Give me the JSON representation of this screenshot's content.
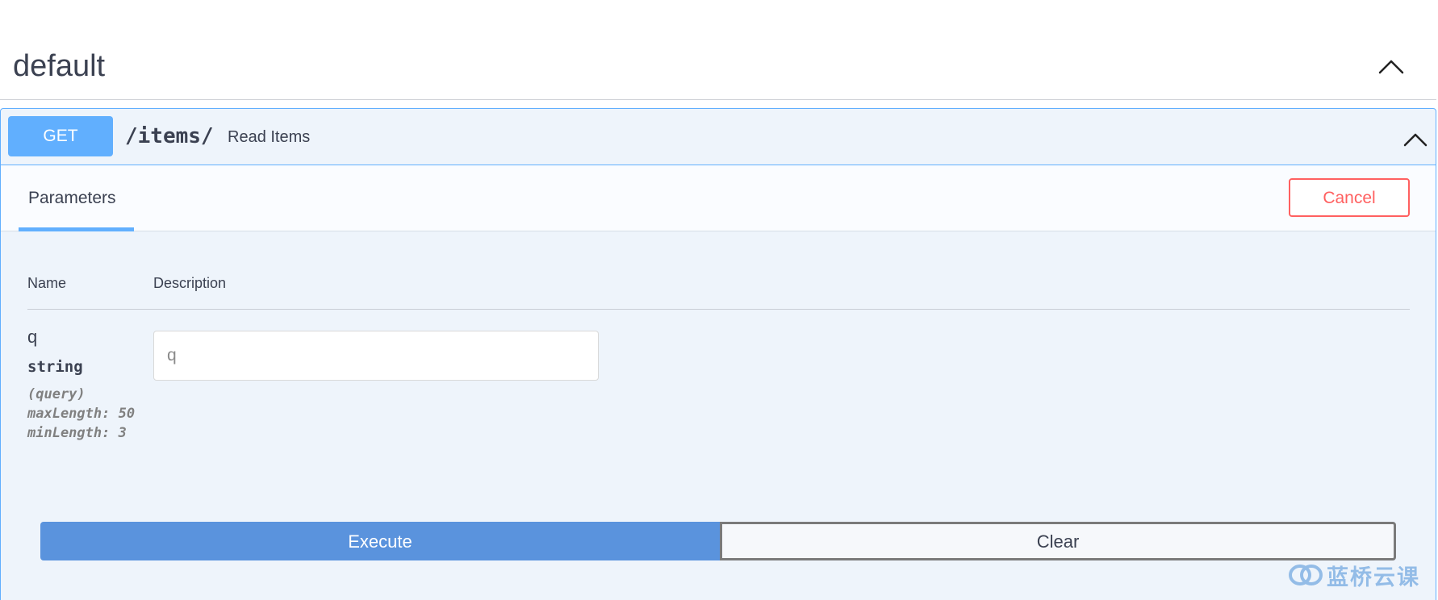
{
  "section": {
    "title": "default",
    "toggle_icon": "chevron-up-icon"
  },
  "operation": {
    "method": "GET",
    "path": "/items/",
    "summary": "Read Items",
    "toggle_icon": "chevron-up-icon",
    "colors": {
      "method_badge": "#61affe",
      "block_background": "#eef4fb",
      "block_border": "#61affe"
    }
  },
  "parameters_panel": {
    "tab_label": "Parameters",
    "cancel_label": "Cancel",
    "cancel_color": "#ff6060",
    "columns": {
      "name": "Name",
      "description": "Description"
    },
    "params": [
      {
        "name": "q",
        "type": "string",
        "in": "(query)",
        "max_length": "maxLength: 50",
        "min_length": "minLength: 3",
        "input_value": "",
        "input_placeholder": "q"
      }
    ]
  },
  "actions": {
    "execute_label": "Execute",
    "clear_label": "Clear",
    "execute_color": "#5a93dd"
  },
  "watermark": {
    "text": "蓝桥云课"
  }
}
